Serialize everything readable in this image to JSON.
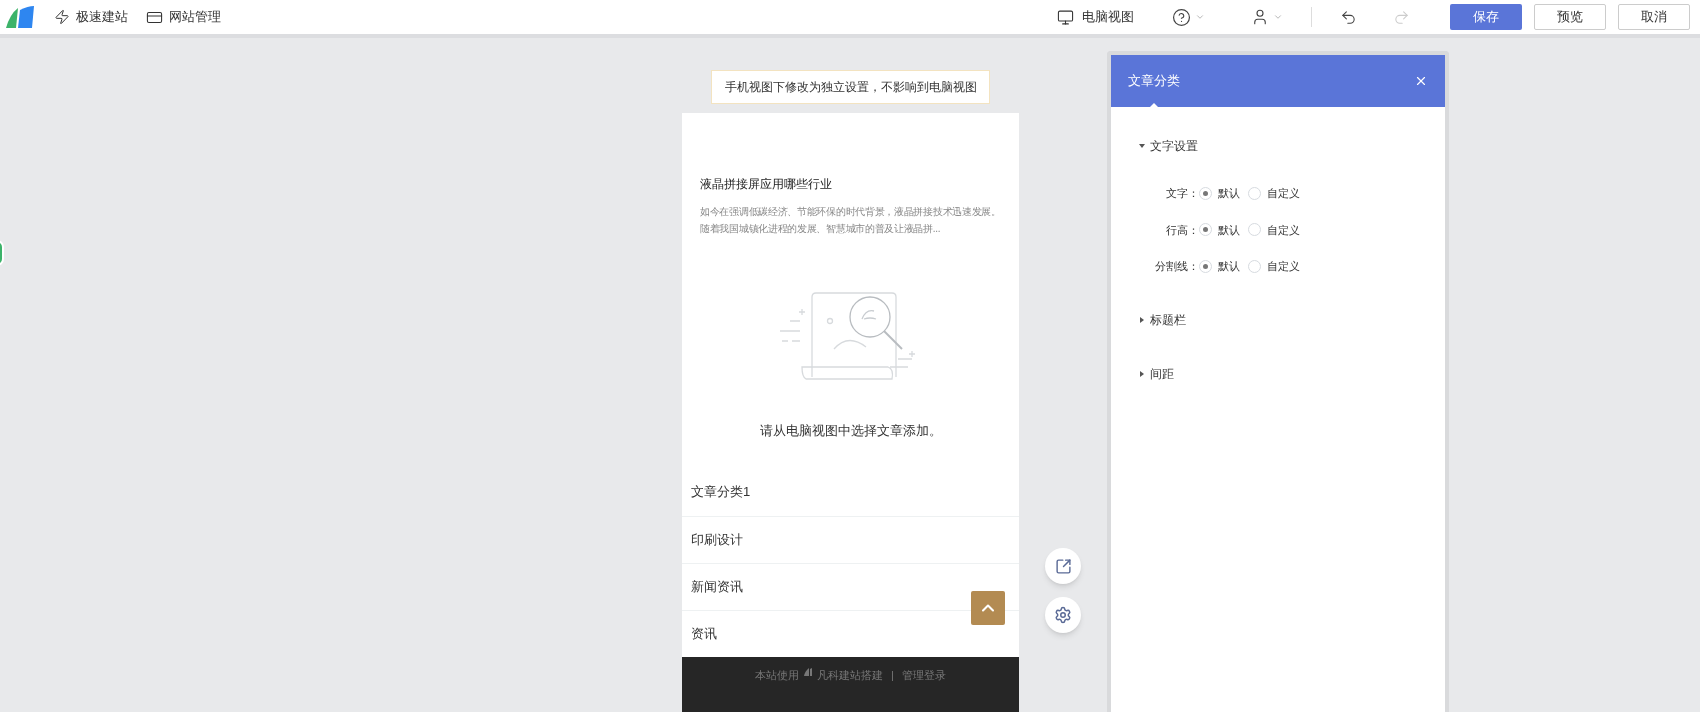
{
  "toolbar": {
    "left": [
      {
        "kind": "bolt",
        "label": "极速建站"
      },
      {
        "kind": "card",
        "label": "网站管理"
      }
    ],
    "view": {
      "label": "电脑视图"
    },
    "buttons": [
      {
        "label": "保存",
        "primary": true
      },
      {
        "label": "预览",
        "primary": false
      },
      {
        "label": "取消",
        "primary": false
      }
    ]
  },
  "notice": "手机视图下修改为独立设置，不影响到电脑视图",
  "article": {
    "title": "液晶拼接屏应用哪些行业",
    "summary": "如今在强调低碳经济、节能环保的时代背景，液晶拼接技术迅速发展。随着我国城镇化进程的发展、智慧城市的普及让液晶拼..."
  },
  "empty_message": "请从电脑视图中选择文章添加。",
  "categories": [
    "文章分类1",
    "印刷设计",
    "新闻资讯",
    "资讯"
  ],
  "footer": {
    "text": "本站使用",
    "brand": "凡科建站搭建",
    "separator": "|",
    "link": "管理登录"
  },
  "panel": {
    "title": "文章分类",
    "sections": [
      {
        "label": "文字设置",
        "expanded": true,
        "rows": [
          {
            "label": "文字：",
            "options": [
              {
                "label": "默认",
                "selected": true
              },
              {
                "label": "自定义",
                "selected": false
              }
            ]
          },
          {
            "label": "行高：",
            "options": [
              {
                "label": "默认",
                "selected": true
              },
              {
                "label": "自定义",
                "selected": false
              }
            ]
          },
          {
            "label": "分割线：",
            "options": [
              {
                "label": "默认",
                "selected": true
              },
              {
                "label": "自定义",
                "selected": false
              }
            ]
          }
        ]
      },
      {
        "label": "标题栏",
        "expanded": false
      },
      {
        "label": "间距",
        "expanded": false
      }
    ]
  }
}
